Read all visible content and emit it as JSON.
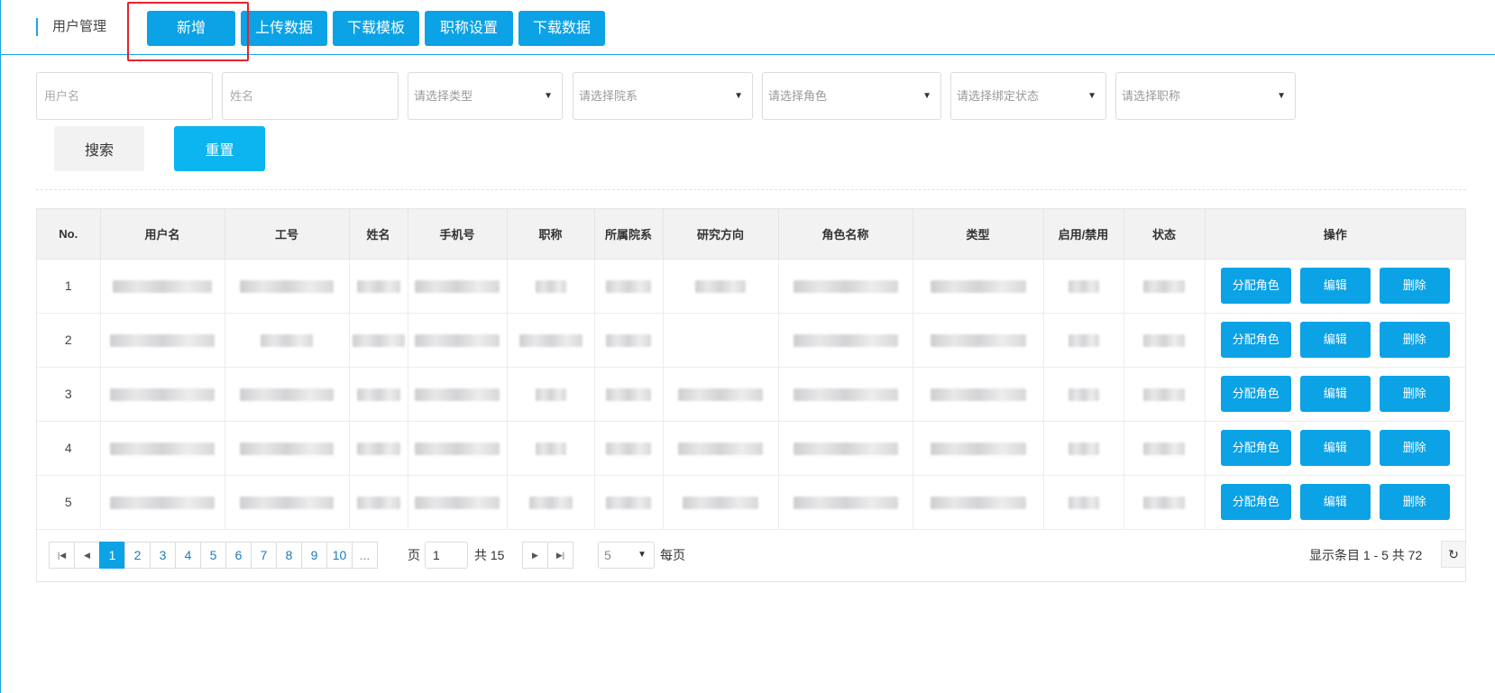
{
  "header": {
    "title": "用户管理",
    "buttons": {
      "add": "新增",
      "upload": "上传数据",
      "download_template": "下载模板",
      "title_settings": "职称设置",
      "download_data": "下载数据"
    }
  },
  "filters": {
    "username_placeholder": "用户名",
    "name_placeholder": "姓名",
    "type_placeholder": "请选择类型",
    "department_placeholder": "请选择院系",
    "role_placeholder": "请选择角色",
    "bind_status_placeholder": "请选择绑定状态",
    "job_title_placeholder": "请选择职称",
    "search_label": "搜索",
    "reset_label": "重置"
  },
  "table": {
    "columns": [
      "No.",
      "用户名",
      "工号",
      "姓名",
      "手机号",
      "职称",
      "所属院系",
      "研究方向",
      "角色名称",
      "类型",
      "启用/禁用",
      "状态",
      "操作"
    ],
    "rows": [
      {
        "no": "1"
      },
      {
        "no": "2"
      },
      {
        "no": "3"
      },
      {
        "no": "4"
      },
      {
        "no": "5"
      }
    ],
    "actions": {
      "assign_role": "分配角色",
      "edit": "编辑",
      "delete": "删除"
    }
  },
  "pagination": {
    "pages": [
      "1",
      "2",
      "3",
      "4",
      "5",
      "6",
      "7",
      "8",
      "9",
      "10",
      "..."
    ],
    "current_page": "1",
    "page_label": "页",
    "total_pages_label": "共 15",
    "page_size": "5",
    "per_page_label": "每页",
    "summary": "显示条目 1 - 5 共 72"
  },
  "icons": {
    "first": "first-page-icon",
    "prev": "prev-page-icon",
    "next": "next-page-icon",
    "last": "last-page-icon",
    "refresh": "refresh-icon"
  },
  "colors": {
    "primary": "#0ba2e6",
    "reset": "#0cb4f0",
    "highlight": "#e8222a"
  }
}
